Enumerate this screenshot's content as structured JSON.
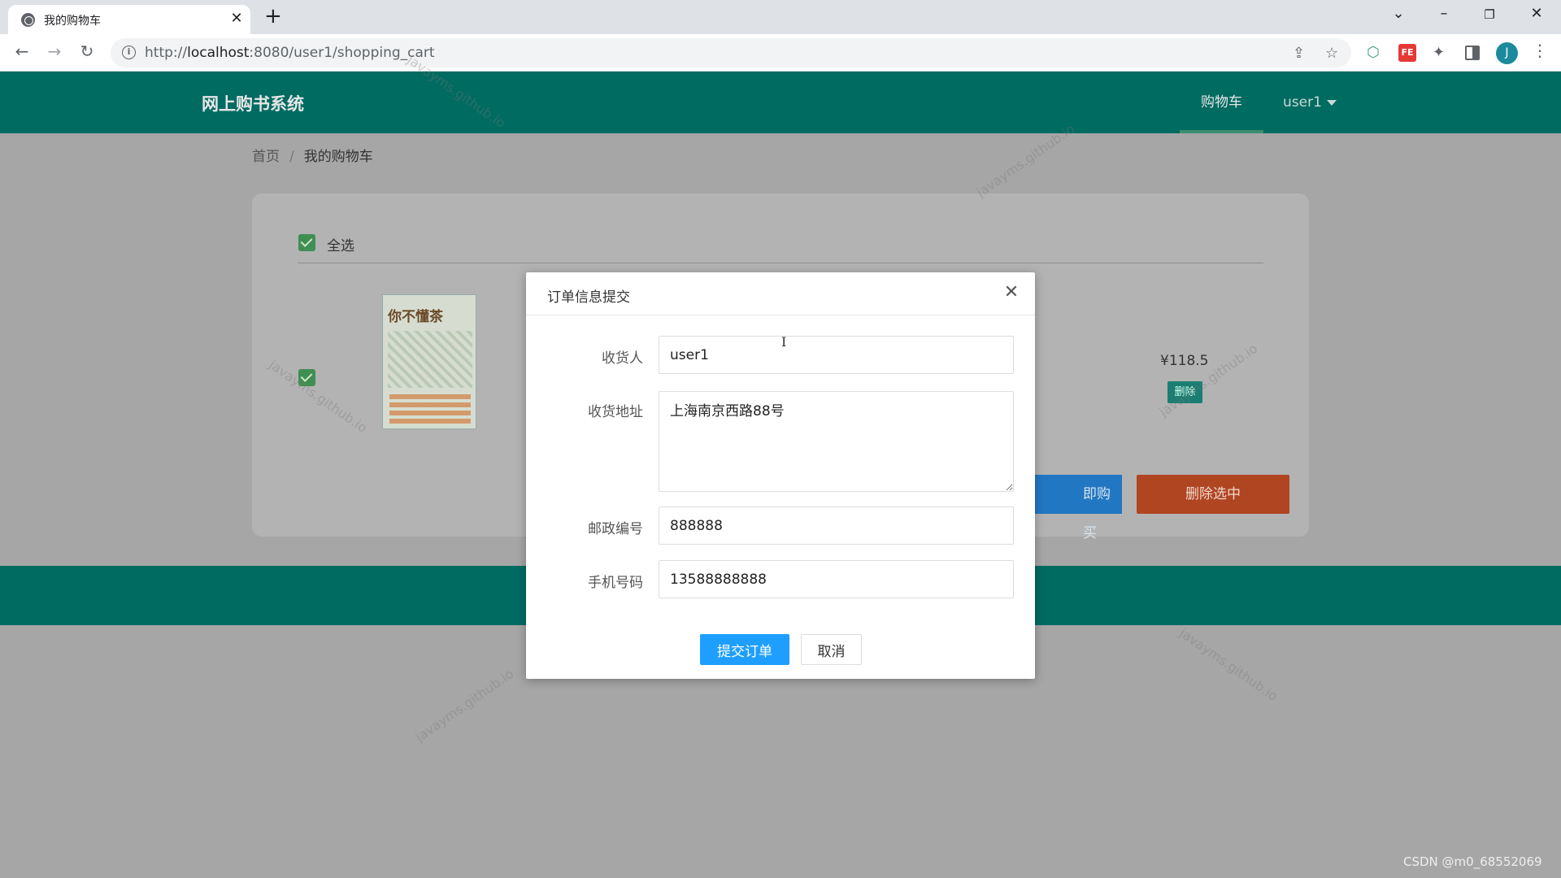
{
  "browser": {
    "tab_title": "我的购物车",
    "url_prefix": "http://",
    "url_host": "localhost",
    "url_path": ":8080/user1/shopping_cart",
    "avatar_letter": "J",
    "fe_ext": "FE"
  },
  "header": {
    "logo": "网上购书系统",
    "nav_cart": "购物车",
    "nav_user": "user1"
  },
  "breadcrumb": {
    "home": "首页",
    "separator": "/",
    "current": "我的购物车"
  },
  "cart": {
    "select_all": "全选",
    "book_title": "你不懂茶",
    "price": "¥118.5",
    "delete": "删除",
    "buy_now": "即购买",
    "delete_selected": "删除选中"
  },
  "dialog": {
    "title": "订单信息提交",
    "receiver_label": "收货人",
    "receiver_value": "user1",
    "address_label": "收货地址",
    "address_value": "上海南京西路88号",
    "zip_label": "邮政编号",
    "zip_value": "888888",
    "phone_label": "手机号码",
    "phone_value": "13588888888",
    "submit": "提交订单",
    "cancel": "取消"
  },
  "watermark_text": "javayms.github.io",
  "csdn_credit": "CSDN @m0_68552069"
}
